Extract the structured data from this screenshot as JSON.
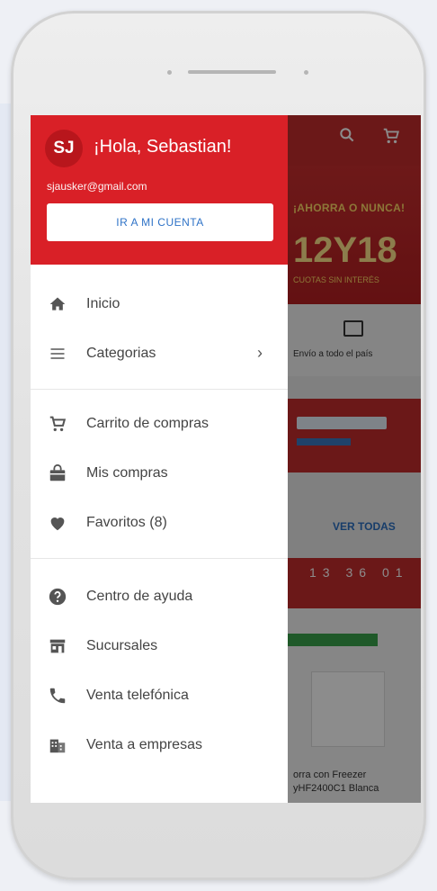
{
  "background_app": {
    "banner_line1": "¡AHORRA O NUNCA!",
    "banner_line2": "12Y18",
    "banner_line3": "CUOTAS SIN INTERÉS",
    "shipping_text": "Envío a todo el país",
    "see_all": "VER TODAS",
    "timer": [
      "13",
      "36",
      "01"
    ],
    "product_name_line1": "orra con Freezer",
    "product_name_line2": "yHF2400C1 Blanca"
  },
  "drawer": {
    "avatar_initials": "SJ",
    "greeting": "¡Hola, Sebastian!",
    "email": "sjausker@gmail.com",
    "account_button": "IR A MI CUENTA",
    "group1": [
      {
        "label": "Inicio",
        "icon": "home-icon"
      },
      {
        "label": "Categorias",
        "icon": "list-icon"
      }
    ],
    "group2": [
      {
        "label": "Carrito de compras",
        "icon": "cart-icon"
      },
      {
        "label": "Mis compras",
        "icon": "bag-icon"
      },
      {
        "label": "Favoritos (8)",
        "icon": "heart-icon"
      }
    ],
    "group3": [
      {
        "label": "Centro de ayuda",
        "icon": "help-icon"
      },
      {
        "label": "Sucursales",
        "icon": "store-icon"
      },
      {
        "label": "Venta telefónica",
        "icon": "phone-icon"
      },
      {
        "label": "Venta a empresas",
        "icon": "building-icon"
      }
    ]
  },
  "colors": {
    "brand_red": "#d92027",
    "link_blue": "#2f73c7"
  }
}
